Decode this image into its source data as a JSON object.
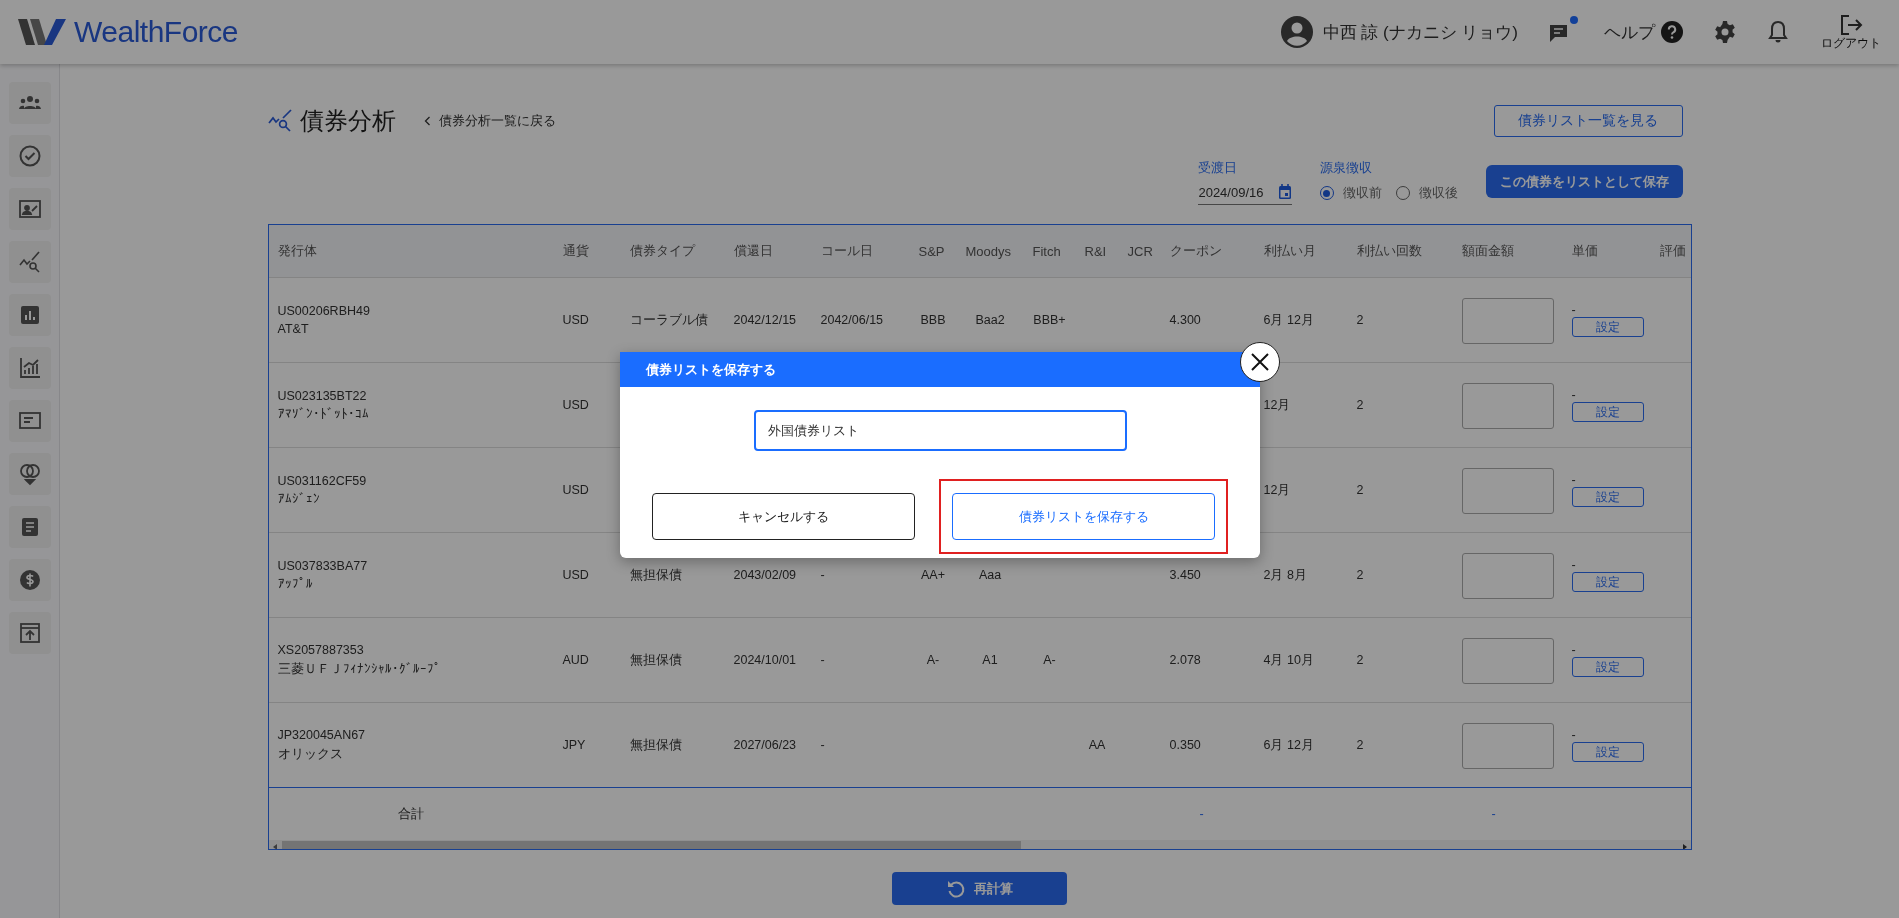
{
  "header": {
    "logo": "WealthForce",
    "user_name": "中西 諒 (ナカニシ リョウ)",
    "chat_unread": true,
    "help": "ヘルプ",
    "logout": "ログアウト"
  },
  "page": {
    "title": "債券分析",
    "back_link": "債券分析一覧に戻る",
    "list_button": "債券リスト一覧を見る"
  },
  "controls": {
    "date_label": "受渡日",
    "date_value": "2024/09/16",
    "tax_label": "源泉徴収",
    "tax_options": [
      {
        "label": "徴収前",
        "selected": true
      },
      {
        "label": "徴収後",
        "selected": false
      }
    ],
    "save_button": "この債券をリストとして保存"
  },
  "table": {
    "columns": [
      "発行体",
      "通貨",
      "債券タイプ",
      "償還日",
      "コール日",
      "S&P",
      "Moodys",
      "Fitch",
      "R&I",
      "JCR",
      "クーポン",
      "利払い月",
      "利払い回数",
      "額面金額",
      "単価",
      "評価"
    ],
    "rows": [
      {
        "code": "US00206RBH49",
        "name": "AT&T",
        "currency": "USD",
        "type": "コーラブル債",
        "maturity": "2042/12/15",
        "call": "2042/06/15",
        "sp": "BBB",
        "moodys": "Baa2",
        "fitch": "BBB+",
        "coupon": "4.300",
        "pay_months": "6月 12月",
        "pay_count": "2",
        "unit_price": "-",
        "set_button": "設定"
      },
      {
        "code": "US023135BT22",
        "name": "ｱﾏｿﾞﾝ･ﾄﾞｯﾄ･ｺﾑ",
        "currency": "USD",
        "pay_months": "12月",
        "pay_count": "2",
        "unit_price": "-",
        "set_button": "設定"
      },
      {
        "code": "US031162CF59",
        "name": "ｱﾑｼﾞｪﾝ",
        "currency": "USD",
        "pay_months": "12月",
        "pay_count": "2",
        "unit_price": "-",
        "set_button": "設定"
      },
      {
        "code": "US037833BA77",
        "name": "ｱｯﾌﾟﾙ",
        "currency": "USD",
        "type": "無担保債",
        "maturity": "2043/02/09",
        "call": "-",
        "sp": "AA+",
        "moodys": "Aaa",
        "coupon": "3.450",
        "pay_months": "2月 8月",
        "pay_count": "2",
        "unit_price": "-",
        "set_button": "設定"
      },
      {
        "code": "XS2057887353",
        "name": "三菱ＵＦＪﾌｨﾅﾝｼｬﾙ･ｸﾞﾙｰﾌﾟ",
        "currency": "AUD",
        "type": "無担保債",
        "maturity": "2024/10/01",
        "call": "-",
        "sp": "A-",
        "moodys": "A1",
        "fitch": "A-",
        "coupon": "2.078",
        "pay_months": "4月 10月",
        "pay_count": "2",
        "unit_price": "-",
        "set_button": "設定"
      },
      {
        "code": "JP320045AN67",
        "name": "オリックス",
        "currency": "JPY",
        "type": "無担保債",
        "maturity": "2027/06/23",
        "call": "-",
        "ri": "AA",
        "coupon": "0.350",
        "pay_months": "6月 12月",
        "pay_count": "2",
        "unit_price": "-",
        "set_button": "設定"
      }
    ],
    "total_label": "合計",
    "total_coupon": "-",
    "total_face": "-"
  },
  "recalc_button": "再計算",
  "dialog": {
    "title": "債券リストを保存する",
    "input_value": "外国債券リスト",
    "cancel_button": "キャンセルする",
    "save_button": "債券リストを保存する",
    "save_highlighted": true
  }
}
